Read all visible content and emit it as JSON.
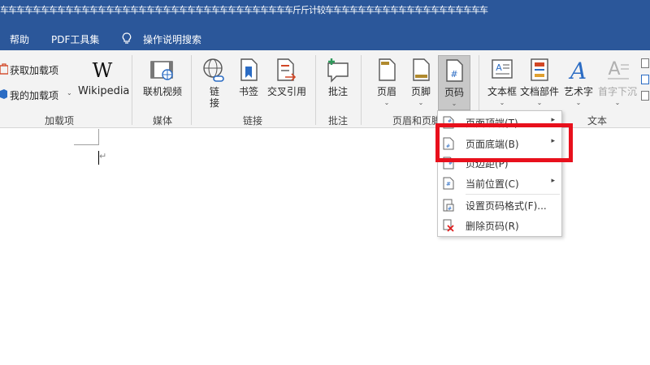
{
  "title_bar": {
    "text": "车车车车车车车车车车车车车车车车车车车车车车车车车车车车车车车车车车车车斤斤计较车车车车车车车车车车车车车车车车车车车车"
  },
  "menu": {
    "tabs": [
      "帮助",
      "PDF工具集"
    ],
    "tell_me": "操作说明搜索"
  },
  "ribbon": {
    "addins": {
      "get_addins": "获取加载项",
      "my_addins": "我的加载项",
      "wikipedia": "Wikipedia",
      "group": "加载项"
    },
    "media": {
      "online_video": "联机视频",
      "group": "媒体"
    },
    "links": {
      "link_line1": "链",
      "link_line2": "接",
      "bookmark": "书签",
      "cross_ref": "交叉引用",
      "group": "链接"
    },
    "comments": {
      "comment": "批注",
      "group": "批注"
    },
    "header_footer": {
      "header": "页眉",
      "footer": "页脚",
      "page_number": "页码",
      "group": "页眉和页脚"
    },
    "text": {
      "textbox": "文本框",
      "quick_parts": "文档部件",
      "wordart": "艺术字",
      "dropcap": "首字下沉",
      "group": "文本"
    }
  },
  "document": {
    "paragraph_mark": "↵"
  },
  "page_number_menu": {
    "items": [
      {
        "label": "页面顶端(T)",
        "has_submenu": true
      },
      {
        "label": "页面底端(B)",
        "has_submenu": true
      },
      {
        "label": "页边距(P)",
        "has_submenu": true
      },
      {
        "label": "当前位置(C)",
        "has_submenu": true
      },
      {
        "label": "设置页码格式(F)...",
        "has_submenu": false
      },
      {
        "label": "删除页码(R)",
        "has_submenu": false
      }
    ],
    "submenu_arrow": "▸"
  },
  "colors": {
    "title_bar": "#2b579a",
    "highlight": "#e8101c",
    "ribbon_bg": "#f3f3f3"
  },
  "icons": [
    "store-icon",
    "my-addins-icon",
    "wikipedia-icon",
    "online-video-icon",
    "link-icon",
    "bookmark-icon",
    "cross-reference-icon",
    "comment-icon",
    "header-icon",
    "footer-icon",
    "page-number-icon",
    "textbox-icon",
    "quick-parts-icon",
    "wordart-icon",
    "dropcap-icon",
    "lightbulb-icon"
  ]
}
